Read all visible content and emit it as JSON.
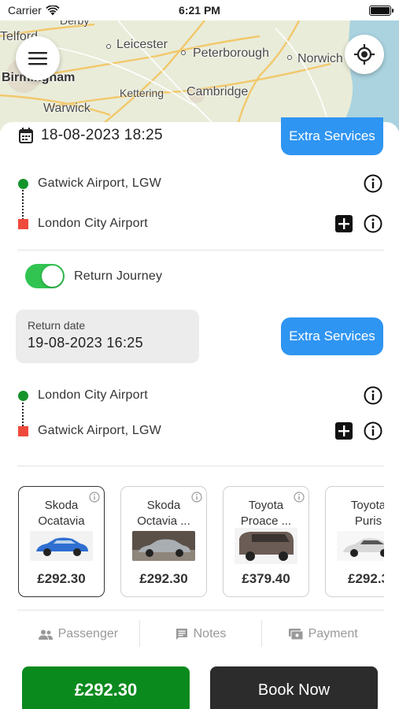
{
  "status_bar": {
    "carrier": "Carrier",
    "time": "6:21 PM",
    "battery_level": 1.0
  },
  "map": {
    "labels": {
      "telford": "Telford",
      "derby": "Derby",
      "leicester": "Leicester",
      "peterborough": "Peterborough",
      "norwich": "Norwich",
      "birmingham": "Birmingham",
      "kettering": "Kettering",
      "cambridge": "Cambridge",
      "warwick": "Warwick"
    },
    "colors": {
      "land": "#e9ecd9",
      "sea": "#aad3df",
      "road": "#f2c86b"
    }
  },
  "journey": {
    "pickup_datetime": "18-08-2023 18:25",
    "extra_services_label": "Extra Services",
    "from": "Gatwick Airport, LGW",
    "to": "London City Airport"
  },
  "return_journey": {
    "toggle_label": "Return Journey",
    "toggle_on": true,
    "date_label": "Return date",
    "date_value": "19-08-2023 16:25",
    "extra_services_label": "Extra Services",
    "from": "London City Airport",
    "to": "Gatwick Airport, LGW"
  },
  "cars": [
    {
      "name_line1": "Skoda",
      "name_line2": "Ocatavia",
      "price": "£292.30",
      "color": "#2f6fd1",
      "selected": true
    },
    {
      "name_line1": "Skoda",
      "name_line2": "Octavia ...",
      "price": "£292.30",
      "color": "#9aa0a6",
      "selected": false
    },
    {
      "name_line1": "Toyota",
      "name_line2": "Proace ...",
      "price": "£379.40",
      "color": "#6b5c55",
      "selected": false
    },
    {
      "name_line1": "Toyota",
      "name_line2": "Puris",
      "price": "£292.3",
      "color": "#d8d8d8",
      "selected": false
    }
  ],
  "tabs": [
    {
      "label": "Passenger",
      "icon": "people-icon"
    },
    {
      "label": "Notes",
      "icon": "notes-icon"
    },
    {
      "label": "Payment",
      "icon": "payment-icon"
    }
  ],
  "actions": {
    "total_price": "£292.30",
    "book_label": "Book Now",
    "colors": {
      "price": "#0a8a1d",
      "book": "#2c2c2c",
      "accent": "#2f95f2"
    }
  }
}
